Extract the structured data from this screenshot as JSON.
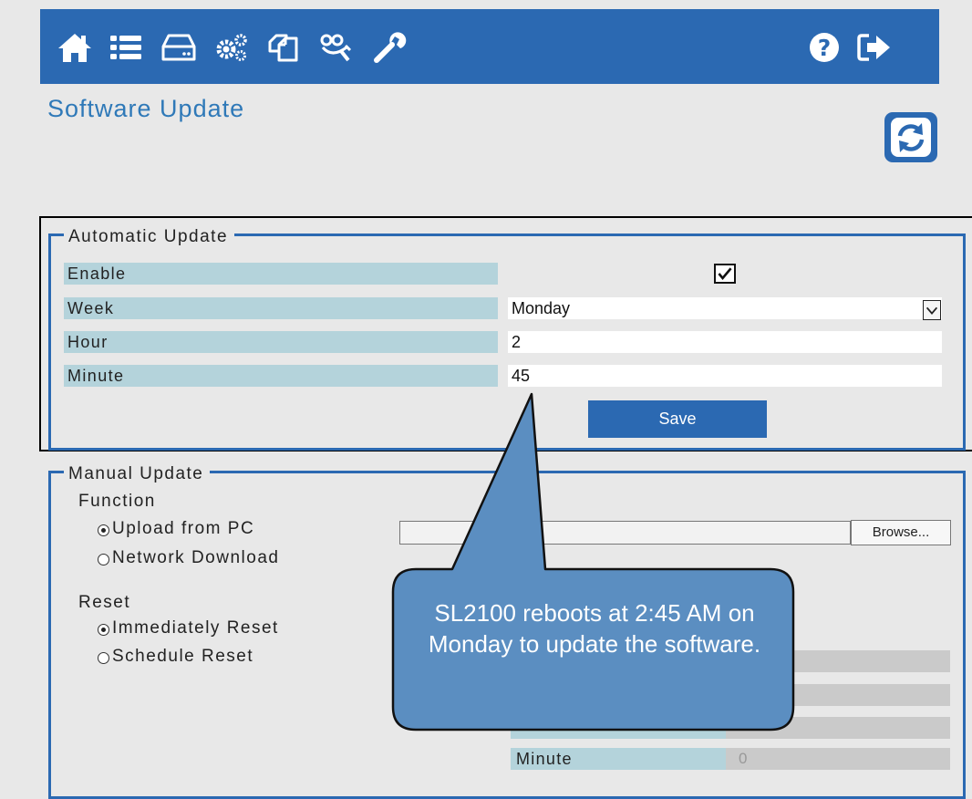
{
  "nav": {
    "icons": [
      "home-icon",
      "list-icon",
      "storage-icon",
      "settings-icon",
      "copy-icon",
      "network-icon",
      "tools-icon",
      "help-icon",
      "logout-icon"
    ]
  },
  "page": {
    "title": "Software Update"
  },
  "automatic_update": {
    "legend": "Automatic Update",
    "enable_label": "Enable",
    "enabled": true,
    "week_label": "Week",
    "week_value": "Monday",
    "hour_label": "Hour",
    "hour_value": "2",
    "minute_label": "Minute",
    "minute_value": "45",
    "save_label": "Save"
  },
  "manual_update": {
    "legend": "Manual Update",
    "function_label": "Function",
    "upload_label": "Upload from PC",
    "network_label": "Network Download",
    "browse_label": "Browse...",
    "reset_label": "Reset",
    "immediately_label": "Immediately Reset",
    "schedule_label": "Schedule Reset",
    "minute_label": "Minute",
    "minute_value": "0"
  },
  "callout": {
    "text": "SL2100 reboots at 2:45 AM on Monday to update the software."
  },
  "colors": {
    "primary": "#2b69b2",
    "label_bg": "#b4d3db",
    "title": "#2f79b8",
    "callout": "#5b8ec1",
    "background": "#e8e8e8"
  }
}
